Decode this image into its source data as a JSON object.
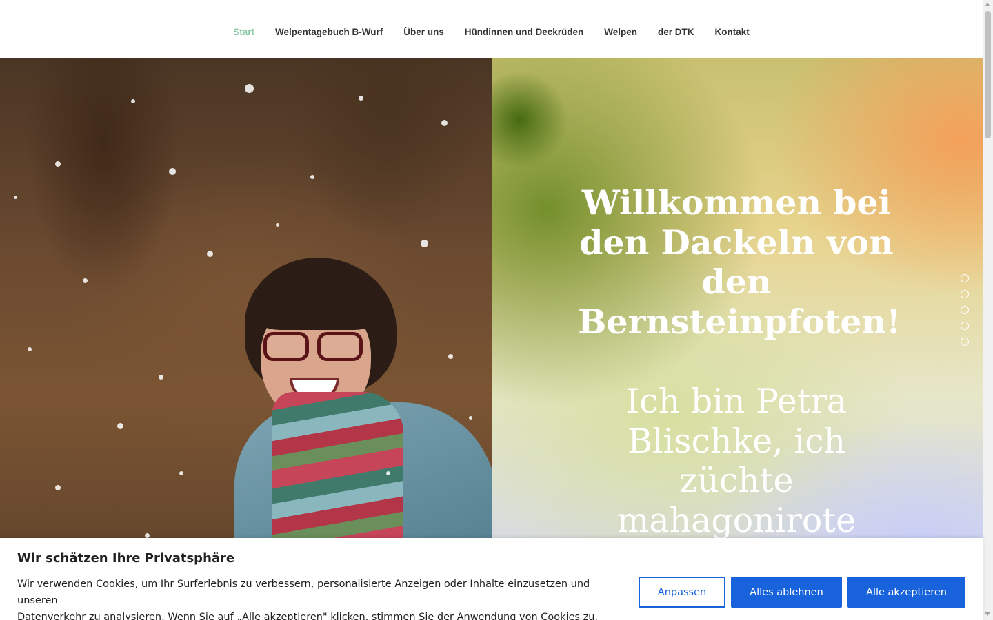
{
  "nav": {
    "items": [
      {
        "label": "Start"
      },
      {
        "label": "Welpentagebuch B-Wurf"
      },
      {
        "label": "Über uns"
      },
      {
        "label": "Hündinnen und Deckrüden"
      },
      {
        "label": "Welpen"
      },
      {
        "label": "der DTK"
      },
      {
        "label": "Kontakt"
      }
    ],
    "active": "Start",
    "active_color": "#8cc8a8"
  },
  "hero": {
    "welcome_line1": "Willkommen bei",
    "welcome_line2": "den Dackeln von",
    "welcome_line3": "den",
    "welcome_line4": "Bernsteinpfoten!",
    "intro_line1": "Ich bin Petra",
    "intro_line2": "Blischke,  ich",
    "intro_line3": "züchte",
    "intro_line4": "mahagonirote",
    "slider_dot_count": 5
  },
  "cookie_banner": {
    "title": "Wir schätzen Ihre Privatsphäre",
    "text_line1": "Wir verwenden Cookies, um Ihr Surferlebnis zu verbessern, personalisierte Anzeigen oder Inhalte einzusetzen und unseren",
    "text_line2": "Datenverkehr zu analysieren. Wenn Sie auf „Alle akzeptieren\" klicken, stimmen Sie der Anwendung von Cookies zu.",
    "customize_label": "Anpassen",
    "reject_label": "Alles ablehnen",
    "accept_label": "Alle akzeptieren",
    "button_color": "#1863dc"
  }
}
